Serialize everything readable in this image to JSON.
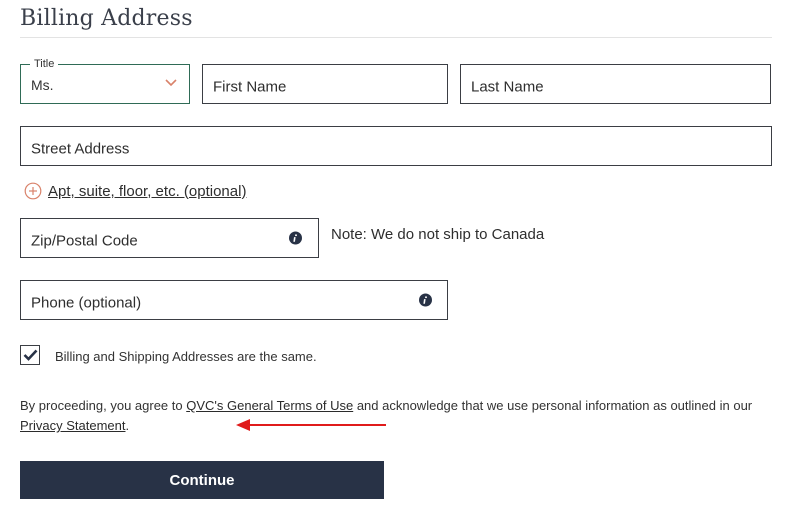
{
  "page": {
    "title": "Billing Address"
  },
  "form": {
    "title_select": {
      "legend": "Title",
      "value": "Ms."
    },
    "first_name": {
      "placeholder": "First Name"
    },
    "last_name": {
      "placeholder": "Last Name"
    },
    "street_address": {
      "placeholder": "Street Address"
    },
    "apt_link": {
      "label": "Apt, suite, floor, etc. (optional)"
    },
    "zip": {
      "placeholder": "Zip/Postal Code"
    },
    "zip_note": "Note: We do not ship to Canada",
    "phone": {
      "placeholder": "Phone (optional)"
    },
    "same_address": {
      "label": "Billing and Shipping Addresses are the same.",
      "checked": true
    }
  },
  "legal": {
    "prefix": "By proceeding, you agree to ",
    "terms_link": "QVC's General Terms of Use",
    "middle": " and acknowledge that we use personal information as outlined in our ",
    "privacy_link": "Privacy Statement",
    "suffix": "."
  },
  "actions": {
    "continue_label": "Continue"
  },
  "colors": {
    "button_bg": "#283246",
    "select_border": "#2f6b56",
    "add_icon": "#d9826a",
    "arrow": "#e01b1b"
  },
  "icons": {
    "select_chevron": "chevron-down-icon",
    "add": "plus-circle-icon",
    "info": "info-icon",
    "check": "checkmark-icon",
    "annotation": "arrow-left-icon"
  }
}
